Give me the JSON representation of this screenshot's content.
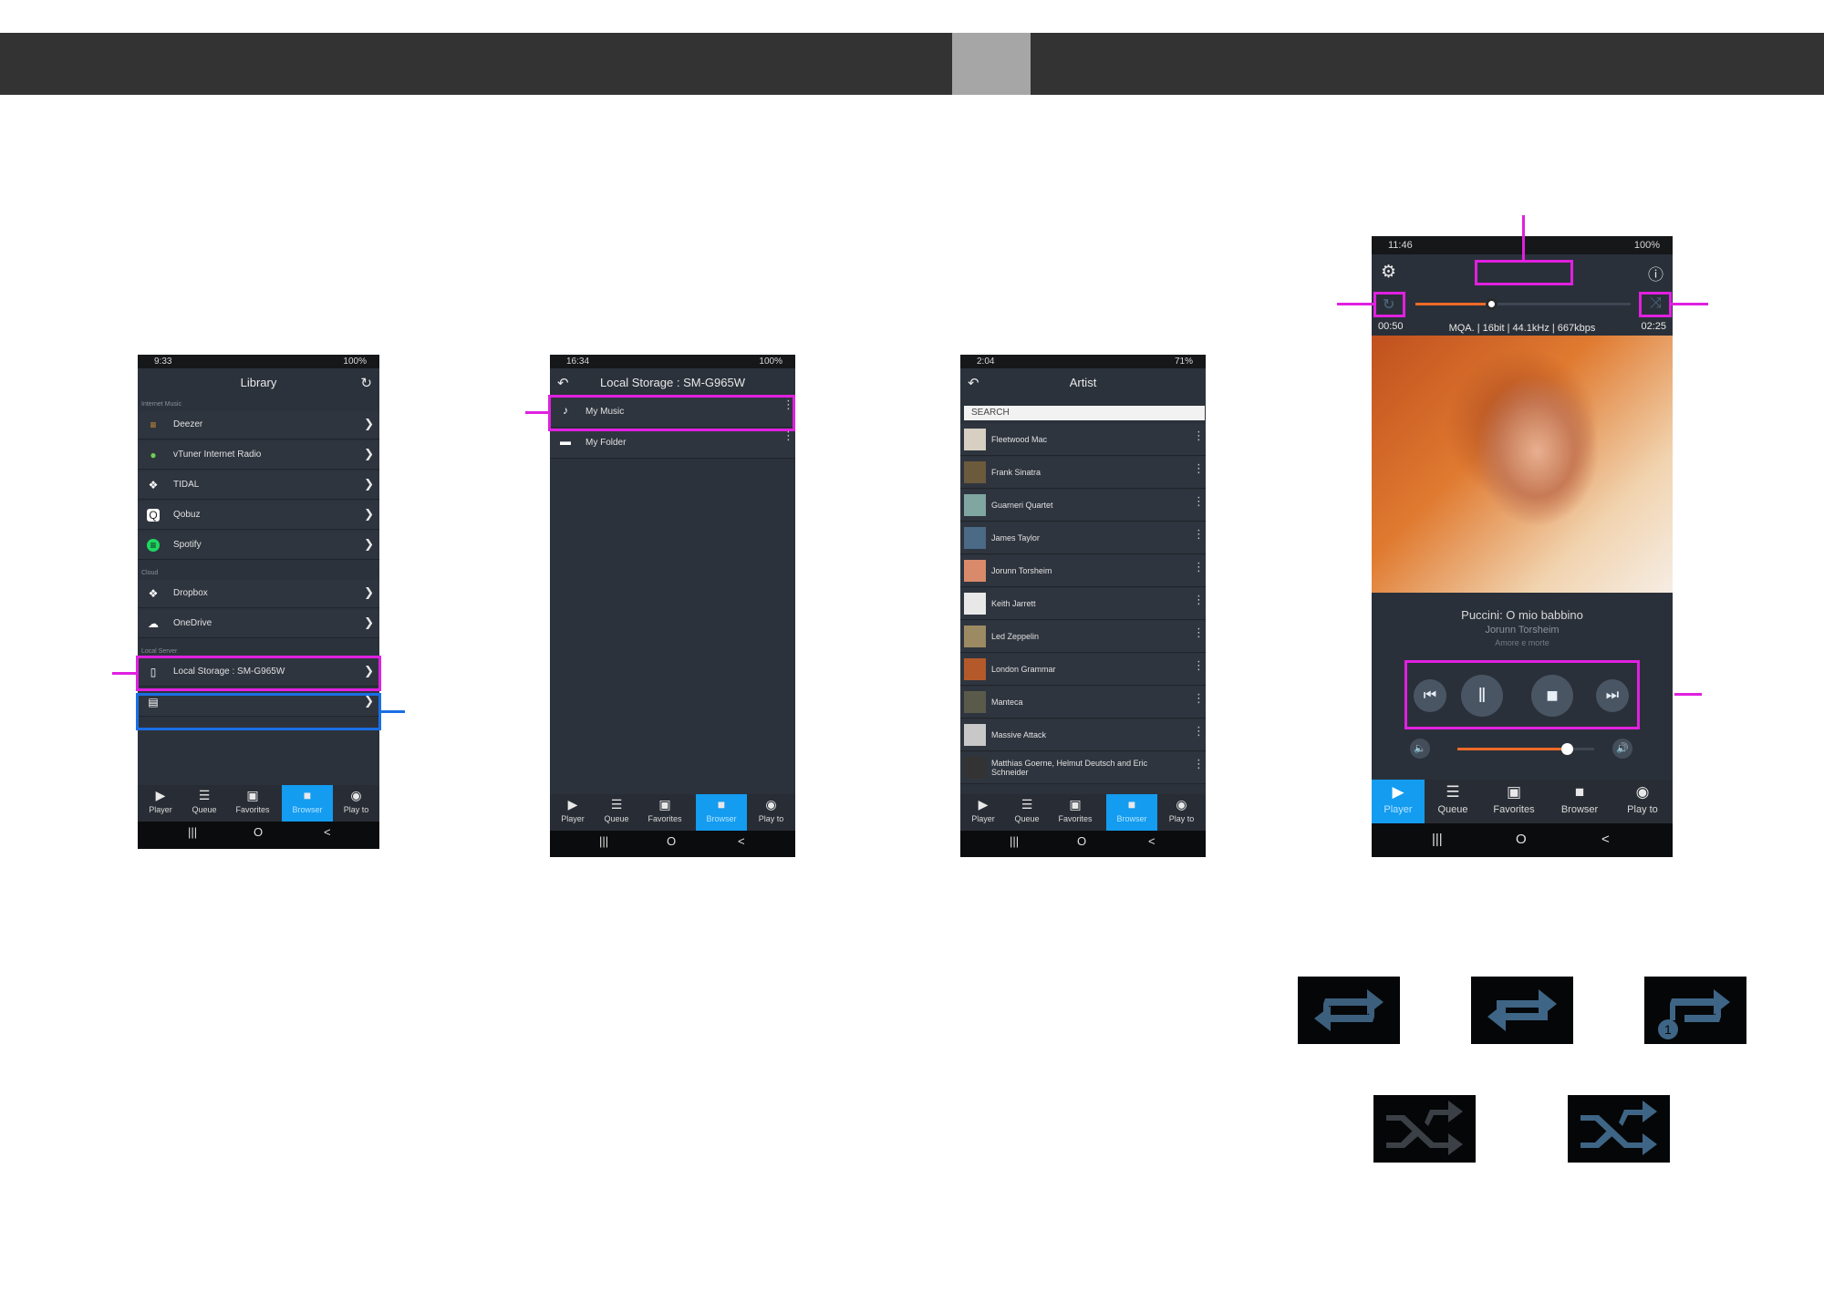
{
  "colors": {
    "highlight_magenta": "#e020e0",
    "highlight_blue": "#1a6fe6",
    "nav_active": "#139cf0",
    "phone_bg": "#2c323c",
    "header_bar": "#333333"
  },
  "phone1": {
    "status_time": "9:33",
    "status_right": "100%",
    "title": "Library",
    "refresh_icon": "refresh-icon",
    "sections": [
      "Internet Music",
      "Cloud",
      "Local Server"
    ],
    "internet_items": [
      "Deezer",
      "vTuner Internet Radio",
      "TIDAL",
      "Qobuz",
      "Spotify"
    ],
    "cloud_items": [
      "Dropbox",
      "OneDrive"
    ],
    "local_item": "Local Storage : SM-G965W"
  },
  "phone2": {
    "status_time": "16:34",
    "status_right": "100%",
    "title": "Local Storage : SM-G965W",
    "items": [
      "My Music",
      "My Folder"
    ]
  },
  "phone3": {
    "status_time": "2:04",
    "status_right": "71%",
    "title": "Artist",
    "search_placeholder": "SEARCH",
    "artists": [
      "Fleetwood Mac",
      "Frank Sinatra",
      "Guarneri Quartet",
      "James Taylor",
      "Jorunn Torsheim",
      "Keith Jarrett",
      "Led Zeppelin",
      "London Grammar",
      "Manteca",
      "Massive Attack",
      "Matthias Goerne, Helmut Deutsch and Eric Schneider"
    ]
  },
  "phone4": {
    "status_time": "11:46",
    "status_right": "100%",
    "elapsed": "00:50",
    "total": "02:25",
    "format": "MQA. | 16bit | 44.1kHz | 667kbps",
    "track": "Puccini: O mio babbino",
    "artist": "Jorunn Torsheim",
    "album": "Amore e morte",
    "progress": 0.35,
    "volume": 0.8
  },
  "nav": {
    "player": "Player",
    "queue": "Queue",
    "favorites": "Favorites",
    "browser": "Browser",
    "play_to": "Play to"
  },
  "sysbar": {
    "recent": "|||",
    "home": "O",
    "back": "<"
  }
}
